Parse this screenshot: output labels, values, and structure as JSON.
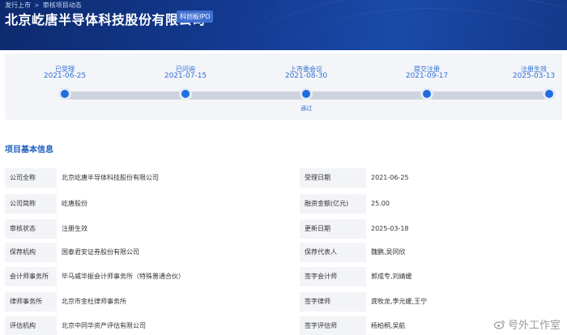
{
  "breadcrumb": {
    "items": [
      "发行上市",
      "审核项目动态"
    ],
    "separator": ">"
  },
  "company": {
    "title": "北京屹唐半导体科技股份有限公司",
    "board": "科创板IPO"
  },
  "timeline": [
    {
      "label": "已受理",
      "date": "2021-06-25",
      "note": ""
    },
    {
      "label": "已问询",
      "date": "2021-07-15",
      "note": ""
    },
    {
      "label": "上市委会议",
      "date": "2021-08-30",
      "note": "通过"
    },
    {
      "label": "提交注册",
      "date": "2021-09-17",
      "note": ""
    },
    {
      "label": "注册生效",
      "date": "2025-03-13",
      "note": ""
    }
  ],
  "section": {
    "title": "项目基本信息"
  },
  "info_rows": [
    {
      "left_label": "公司全称",
      "left_value": "北京屹唐半导体科技股份有限公司",
      "right_label": "受理日期",
      "right_value": "2021-06-25"
    },
    {
      "left_label": "公司简称",
      "left_value": "屹唐股份",
      "right_label": "融资金额(亿元)",
      "right_value": "25.00"
    },
    {
      "left_label": "审核状态",
      "left_value": "注册生效",
      "right_label": "更新日期",
      "right_value": "2025-03-18"
    },
    {
      "left_label": "保荐机构",
      "left_value": "国泰君安证券股份有限公司",
      "right_label": "保荐代表人",
      "right_value": "魏鹏,吴同欣"
    },
    {
      "left_label": "会计师事务所",
      "left_value": "毕马威华振会计师事务所（特殊普通合伙）",
      "right_label": "签字会计师",
      "right_value": "郭成专,刘婧媛"
    },
    {
      "left_label": "律师事务所",
      "left_value": "北京市金杜律师事务所",
      "right_label": "签字律师",
      "right_value": "龚牧龙,李元媛,王宁"
    },
    {
      "left_label": "评估机构",
      "left_value": "北京中同华资产评估有限公司",
      "right_label": "签字评估师",
      "right_value": "杨柏桐,吴航"
    }
  ],
  "watermark": {
    "text": "号外工作室"
  },
  "colors": {
    "banner": "#143c94",
    "accent": "#1f6ee0",
    "label_bg": "#f3f4f7"
  }
}
